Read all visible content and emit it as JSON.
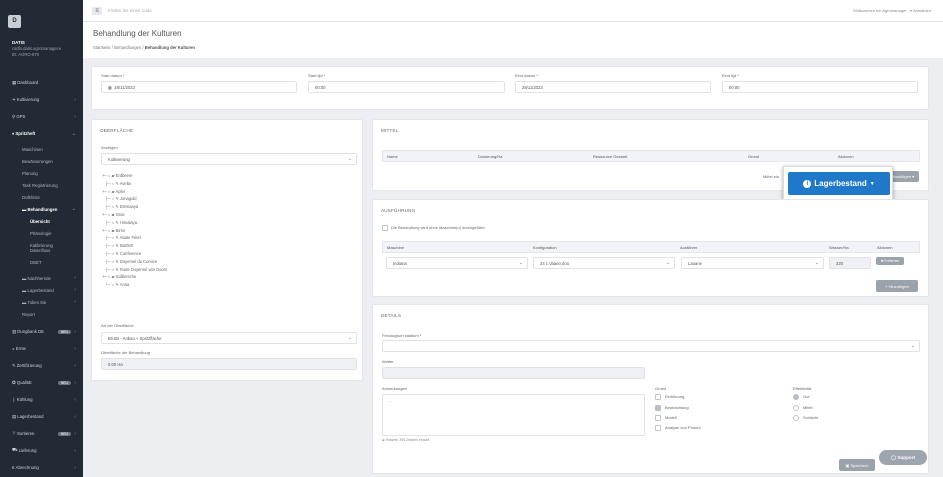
{
  "sidebar": {
    "logo_letter": "D",
    "org_name": "DATIS",
    "org_email": "csdfo.datis.agromanager.e",
    "org_id": "ID: AGRO-870",
    "items": [
      {
        "label": "Dashboard",
        "icon": "dashboard-icon"
      },
      {
        "label": "Kultivierung",
        "icon": "leaf-icon"
      },
      {
        "label": "GPS",
        "icon": "map-pin-icon"
      },
      {
        "label": "Spritzheft",
        "icon": "spray-icon"
      },
      {
        "label": "Maschinen"
      },
      {
        "label": "Bewässerungen"
      },
      {
        "label": "Planung"
      },
      {
        "label": "Task Registrierung"
      },
      {
        "label": "Düfkhiste"
      },
      {
        "label": "Behandlungen"
      },
      {
        "label": "Übersicht"
      },
      {
        "label": "Phänologie"
      },
      {
        "label": "Kalibrierung Datenfluss"
      },
      {
        "label": "DBET"
      },
      {
        "label": "Nachhernde"
      },
      {
        "label": "Lagerbestand"
      },
      {
        "label": "Tobes Sie"
      },
      {
        "label": "Report"
      },
      {
        "label": "Dungbank DE",
        "badge": "NEU"
      },
      {
        "label": "Ernte"
      },
      {
        "label": "Zertifizierung"
      },
      {
        "label": "Qualität",
        "badge": "NEU"
      },
      {
        "label": "Kühlung"
      },
      {
        "label": "Lagerbestand"
      },
      {
        "label": "Sortieren",
        "badge": "NEU"
      },
      {
        "label": "Lieferung"
      },
      {
        "label": "Abrechnung"
      }
    ]
  },
  "topbar": {
    "search_placeholder": "Finden Sie einen Code",
    "welcome": "Willkommen bei Agromanager",
    "logout": "Abmelden"
  },
  "page": {
    "title": "Behandlung der Kulturen",
    "breadcrumb": [
      "Startseite",
      "Behandlungen",
      "Behandlung der Kulturen"
    ]
  },
  "dates": {
    "start_date_label": "Start datum *",
    "start_date": "28/11/2023",
    "start_time_label": "Start tijd *",
    "start_time": "00:00",
    "end_date_label": "Eind datum *",
    "end_date": "28/11/2023",
    "end_time_label": "Eind tijd *",
    "end_time": "00:00"
  },
  "surface": {
    "title": "OBERFLÄCHE",
    "show_label": "Anzeigen",
    "show_value": "Kultivierung",
    "tree": [
      {
        "label": "Erdbeere",
        "level": 0
      },
      {
        "label": "Avelia",
        "level": 1
      },
      {
        "label": "Apfel",
        "level": 0
      },
      {
        "label": "Jonagold",
        "level": 1
      },
      {
        "label": "Elemaaya",
        "level": 1
      },
      {
        "label": "Gras",
        "level": 0
      },
      {
        "label": "Himalaya",
        "level": 1
      },
      {
        "label": "Birne",
        "level": 0
      },
      {
        "label": "Abate Fétel",
        "level": 1
      },
      {
        "label": "Bartlett",
        "level": 1
      },
      {
        "label": "Conference",
        "level": 1
      },
      {
        "label": "Doyenné du Comice",
        "level": 1
      },
      {
        "label": "Rode Doyenné van Doorn",
        "level": 1
      },
      {
        "label": "Süßkirsche",
        "level": 0
      },
      {
        "label": "Anna",
        "level": 1
      }
    ],
    "type_label": "Art der Oberfläche",
    "type_value": "Brutto - Anbau + Spritzfläche",
    "area_label": "Oberfläche der Behandlung",
    "area_value": "0.00 Ha"
  },
  "mittel": {
    "title": "MITTEL",
    "columns": [
      "Name",
      "Dosierung/Ha",
      "Ressource Gesamt",
      "Grund",
      "Aktionen"
    ],
    "add_label": "Mittel ein",
    "add_btn": "Hinzufügen"
  },
  "popover": {
    "button": "Lagerbestand"
  },
  "ausfuehrung": {
    "title": "AUSFÜHRUNG",
    "check_label": "Die Behandlung wird ohne Maschine(n) durchgeführt",
    "columns": [
      "Maschine",
      "Konfiguration",
      "Ausführer",
      "Wasser/Ha",
      "Aktionen"
    ],
    "row": {
      "machine": "Indiana",
      "config": "24 c.Vaaeo doo",
      "executor": "Lauane",
      "water": "320",
      "delete": "Entfernen"
    },
    "add_btn": "Hinzufügen"
  },
  "details": {
    "title": "DETAILS",
    "phen_label": "Fenologisch stadium *",
    "weather_label": "Wetter",
    "notes_label": "Anmerkungen",
    "notes_hint": "Hinweis: 255 Zeichen erlaubt",
    "reason_label": "Grund",
    "reasons": [
      {
        "label": "Einführung",
        "checked": false
      },
      {
        "label": "Beobachtung",
        "checked": true
      },
      {
        "label": "Modell",
        "checked": false
      },
      {
        "label": "Analyse von Proben",
        "checked": false
      }
    ],
    "effect_label": "Effektivität",
    "effects": [
      {
        "label": "Gut",
        "checked": true
      },
      {
        "label": "Mittel",
        "checked": false
      },
      {
        "label": "Schlecht",
        "checked": false
      }
    ],
    "save_btn": "Speichern"
  },
  "support": "Support"
}
